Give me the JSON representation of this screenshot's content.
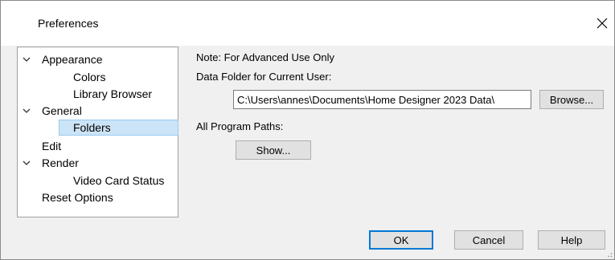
{
  "window": {
    "title": "Preferences"
  },
  "tree": {
    "items": [
      {
        "label": "Appearance",
        "expanded": true,
        "level": 0
      },
      {
        "label": "Colors",
        "level": 1
      },
      {
        "label": "Library Browser",
        "level": 1
      },
      {
        "label": "General",
        "expanded": true,
        "level": 0
      },
      {
        "label": "Folders",
        "level": 1,
        "selected": true
      },
      {
        "label": "Edit",
        "level": 0
      },
      {
        "label": "Render",
        "expanded": true,
        "level": 0
      },
      {
        "label": "Video Card Status",
        "level": 1
      },
      {
        "label": "Reset Options",
        "level": 0
      }
    ]
  },
  "panel": {
    "note": "Note: For Advanced Use Only",
    "data_folder_label": "Data Folder for Current User:",
    "data_folder_value": "C:\\Users\\annes\\Documents\\Home Designer 2023 Data\\",
    "browse_label": "Browse...",
    "program_paths_label": "All Program Paths:",
    "show_label": "Show..."
  },
  "footer": {
    "ok_label": "OK",
    "cancel_label": "Cancel",
    "help_label": "Help"
  },
  "colors": {
    "selection": "#cce4f7",
    "selection_border": "#99c9ef",
    "default_button_border": "#0078d7"
  }
}
